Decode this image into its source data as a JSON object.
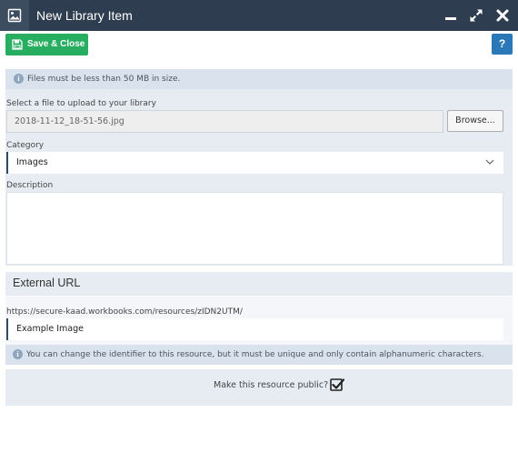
{
  "window": {
    "title": "New Library Item",
    "icon": "image-icon",
    "controls": [
      "minimize-icon",
      "maximize-icon",
      "close-icon"
    ]
  },
  "toolbar": {
    "save_label": "Save & Close",
    "help_label": "?"
  },
  "info": {
    "file_size_notice": "Files must be less than 50 MB in size."
  },
  "file_upload": {
    "label": "Select a file to upload to your library",
    "value": "2018-11-12_18-51-56.jpg",
    "browse_label": "Browse..."
  },
  "category": {
    "label": "Category",
    "selected": "Images"
  },
  "description": {
    "label": "Description",
    "value": ""
  },
  "external_url": {
    "heading": "External URL",
    "base_url": "https://secure-kaad.workbooks.com/resources/zIDN2UTM/",
    "identifier": "Example Image",
    "notice": "You can change the identifier to this resource, but it must be unique and only contain alphanumeric characters."
  },
  "public": {
    "label": "Make this resource public?",
    "checked": true
  },
  "colors": {
    "titlebar": "#2e3d4f",
    "save_button": "#27ae60",
    "help_button": "#2a78b7",
    "panel": "#e7ecf3",
    "info_bar": "#d9e2ed"
  }
}
